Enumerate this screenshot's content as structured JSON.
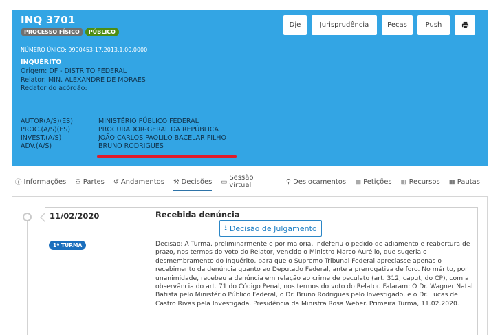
{
  "header": {
    "case_title": "INQ 3701",
    "badges": [
      "PROCESSO FÍSICO",
      "PÚBLICO"
    ],
    "unique_number": "NÚMERO ÚNICO: 9990453-17.2013.1.00.0000",
    "class_name": "INQUÉRITO",
    "origin": "Origem: DF - DISTRITO FEDERAL",
    "rapporteur": "Relator: MIN. ALEXANDRE DE MORAES",
    "judgment_rapporteur": "Redator do acórdão:",
    "parties": [
      {
        "role": "AUTOR(A/S)(ES)",
        "name": "MINISTÉRIO PÚBLICO FEDERAL"
      },
      {
        "role": "PROC.(A/S)(ES)",
        "name": "PROCURADOR-GERAL DA REPÚBLICA"
      },
      {
        "role": "INVEST.(A/S)",
        "name": "JOÃO CARLOS PAOLILO BACELAR FILHO"
      },
      {
        "role": "ADV.(A/S)",
        "name": "BRUNO RODRIGUES"
      }
    ],
    "buttons": {
      "dje": "Dje",
      "jurisprudencia": "Jurisprudência",
      "pecas": "Peças",
      "push": "Push",
      "print_icon": "print-icon"
    },
    "colors": {
      "background": "#33a5e4",
      "underline": "#e01b2a"
    }
  },
  "tabs": [
    {
      "label": "Informações",
      "icon": "info-icon",
      "glyph": "ⓘ"
    },
    {
      "label": "Partes",
      "icon": "users-icon",
      "glyph": "👥"
    },
    {
      "label": "Andamentos",
      "icon": "history-icon",
      "glyph": "↺"
    },
    {
      "label": "Decisões",
      "icon": "gavel-icon",
      "glyph": "⚒",
      "active": true
    },
    {
      "label": "Sessão virtual",
      "icon": "monitor-icon",
      "glyph": "▭"
    },
    {
      "label": "Deslocamentos",
      "icon": "map-marker-icon",
      "glyph": "⚲"
    },
    {
      "label": "Petições",
      "icon": "document-icon",
      "glyph": "▤"
    },
    {
      "label": "Recursos",
      "icon": "file-icon",
      "glyph": "▥"
    },
    {
      "label": "Pautas",
      "icon": "calendar-icon",
      "glyph": "▦"
    }
  ],
  "decision": {
    "date": "11/02/2020",
    "title": "Recebida denúncia",
    "button_label": "Decisão de Julgamento",
    "button_icon": "download-icon",
    "organ_badge": "1ª TURMA",
    "text": "Decisão: A Turma, preliminarmente e por maioria, indeferiu o pedido de adiamento e reabertura de prazo, nos termos do voto do Relator, vencido o Ministro Marco Aurélio, que sugeria o desmembramento do Inquérito, para que o Supremo Tribunal Federal apreciasse apenas o recebimento da denúncia quanto ao Deputado Federal, ante a prerrogativa de foro. No mérito, por unanimidade, recebeu a denúncia em relação ao crime de peculato (art. 312, caput, do CP), com a observância do art. 71 do Código Penal, nos termos do voto do Relator. Falaram: O Dr. Wagner Natal Batista pelo Ministério Público Federal, o Dr. Bruno Rodrigues pelo Investigado, e o Dr. Lucas de Castro Rivas pela Investigada. Presidência da Ministra Rosa Weber. Primeira Turma, 11.02.2020."
  }
}
